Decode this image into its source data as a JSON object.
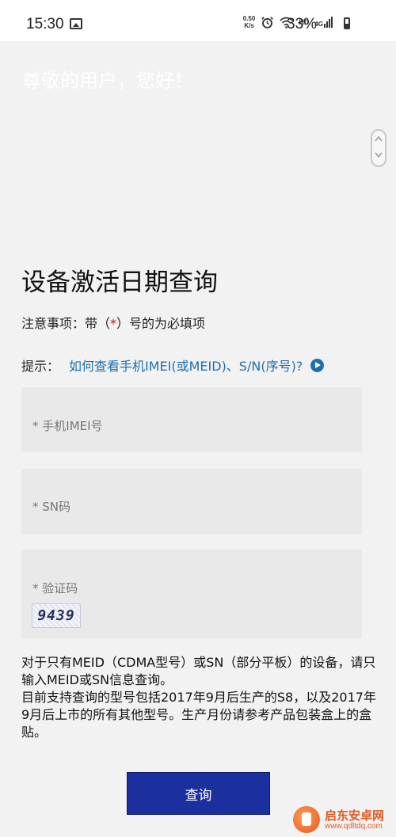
{
  "status_bar": {
    "time": "15:30",
    "speed_top": "0.50",
    "speed_bottom": "K/s",
    "hd": "HD",
    "network": "4G",
    "battery": "33%"
  },
  "page": {
    "greeting": "尊敬的用户，您好！",
    "title": "设备激活日期查询",
    "notice_prefix": "注意事项：带（",
    "notice_required": "*",
    "notice_suffix": "）号的为必填项",
    "tip_label": "提示：",
    "tip_link": "如何查看手机IMEI(或MEID)、S/N(序号)?"
  },
  "form": {
    "imei_placeholder": "* 手机IMEI号",
    "sn_placeholder": "* SN码",
    "captcha_label": "* 验证码",
    "captcha_code": "9439"
  },
  "info": {
    "line1": "对于只有MEID（CDMA型号）或SN（部分平板）的设备，请只输入MEID或SN信息查询。",
    "line2": "目前支持查询的型号包括2017年9月后生产的S8，以及2017年9月后上市的所有其他型号。生产月份请参考产品包装盒上的盒贴。"
  },
  "button": {
    "query": "查询"
  },
  "watermark": {
    "name": "启东安卓网",
    "url": "www.qdltdq.com"
  },
  "colors": {
    "link": "#1f6fae",
    "button": "#1c2f9e",
    "required": "#c0121b"
  }
}
